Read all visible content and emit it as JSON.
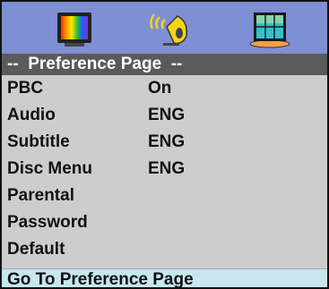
{
  "tabs": [
    {
      "name": "tv-setup",
      "icon": "color-tv-icon"
    },
    {
      "name": "audio-setup",
      "icon": "speaker-sound-icon"
    },
    {
      "name": "preference-setup",
      "icon": "preference-window-icon"
    }
  ],
  "page_title": "--  Preference Page  --",
  "items": [
    {
      "label": "PBC",
      "value": "On"
    },
    {
      "label": "Audio",
      "value": "ENG"
    },
    {
      "label": "Subtitle",
      "value": "ENG"
    },
    {
      "label": "Disc Menu",
      "value": "ENG"
    },
    {
      "label": "Parental",
      "value": ""
    },
    {
      "label": "Password",
      "value": ""
    },
    {
      "label": "Default",
      "value": ""
    }
  ],
  "status": "Go To Preference Page",
  "colors": {
    "icon_bar": "#7e8fd4",
    "title_bar": "#5a5a5a",
    "menu_bg": "#cdcdcd",
    "status_bar": "#c7e7ef"
  }
}
